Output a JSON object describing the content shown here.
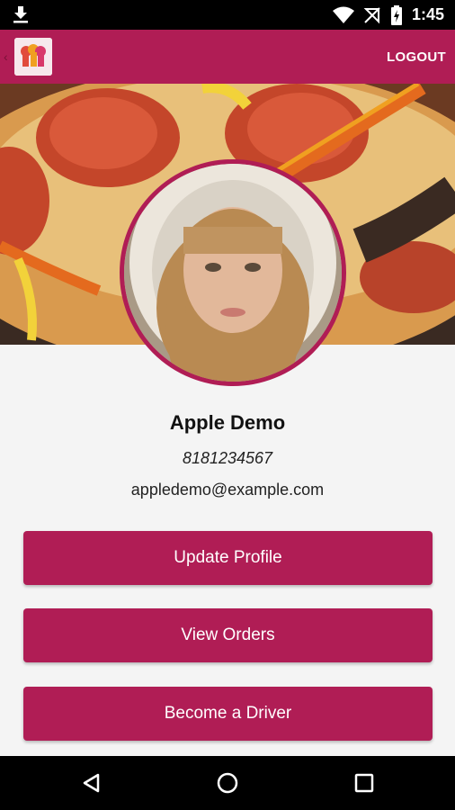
{
  "status_bar": {
    "time": "1:45",
    "icons": [
      "download-icon",
      "wifi-icon",
      "no-sim-icon",
      "battery-charging-icon",
      "signal-icon"
    ]
  },
  "app_bar": {
    "logo_icon": "chef-hats-logo-icon",
    "logout_label": "LOGOUT"
  },
  "profile": {
    "name": "Apple Demo",
    "phone": "8181234567",
    "email": "appledemo@example.com"
  },
  "actions": {
    "update_profile": "Update Profile",
    "view_orders": "View Orders",
    "become_driver": "Become a Driver"
  },
  "nav_bar": {
    "icons": [
      "back-triangle-icon",
      "home-circle-icon",
      "recents-square-icon"
    ]
  },
  "colors": {
    "primary": "#b01d55",
    "status_bar": "#000000",
    "background": "#f4f4f4"
  }
}
